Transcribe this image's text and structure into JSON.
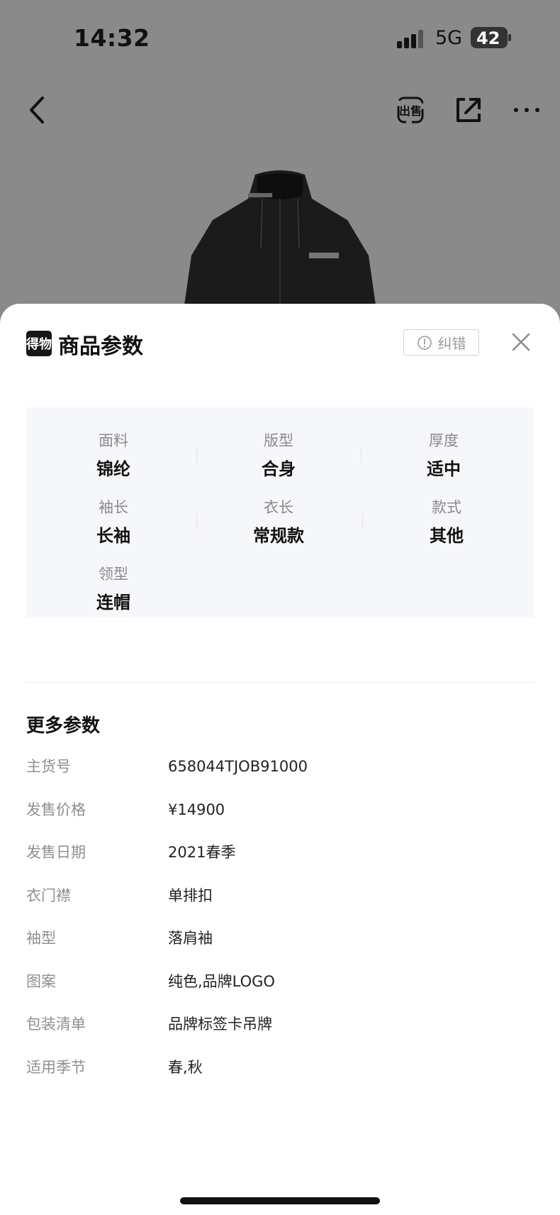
{
  "status_bar": {
    "time": "14:32",
    "network": "5G",
    "battery": "42"
  },
  "nav": {
    "back_icon": "chevron-left-icon",
    "sell_icon": "sell-icon",
    "share_icon": "share-icon",
    "more_icon": "more-horizontal-icon"
  },
  "sheet": {
    "logo_text": "得物",
    "title": "商品参数",
    "correct_label": "纠错",
    "close_icon": "close-icon"
  },
  "key_params": [
    {
      "label": "面料",
      "value": "锦纶"
    },
    {
      "label": "版型",
      "value": "合身"
    },
    {
      "label": "厚度",
      "value": "适中"
    },
    {
      "label": "袖长",
      "value": "长袖"
    },
    {
      "label": "衣长",
      "value": "常规款"
    },
    {
      "label": "款式",
      "value": "其他"
    },
    {
      "label": "领型",
      "value": "连帽"
    }
  ],
  "more_params": {
    "title": "更多参数",
    "rows": [
      {
        "key": "主货号",
        "value": "658044TJOB91000"
      },
      {
        "key": "发售价格",
        "value": "¥14900"
      },
      {
        "key": "发售日期",
        "value": "2021春季"
      },
      {
        "key": "衣门襟",
        "value": "单排扣"
      },
      {
        "key": "袖型",
        "value": "落肩袖"
      },
      {
        "key": "图案",
        "value": "纯色,品牌LOGO"
      },
      {
        "key": "包装清单",
        "value": "品牌标签卡吊牌"
      },
      {
        "key": "适用季节",
        "value": "春,秋"
      }
    ]
  },
  "colors": {
    "overlay": "#8a8a8a",
    "sheet_bg": "#ffffff",
    "param_box_bg": "#f6f7fa",
    "label_gray": "#8a8a8a"
  }
}
